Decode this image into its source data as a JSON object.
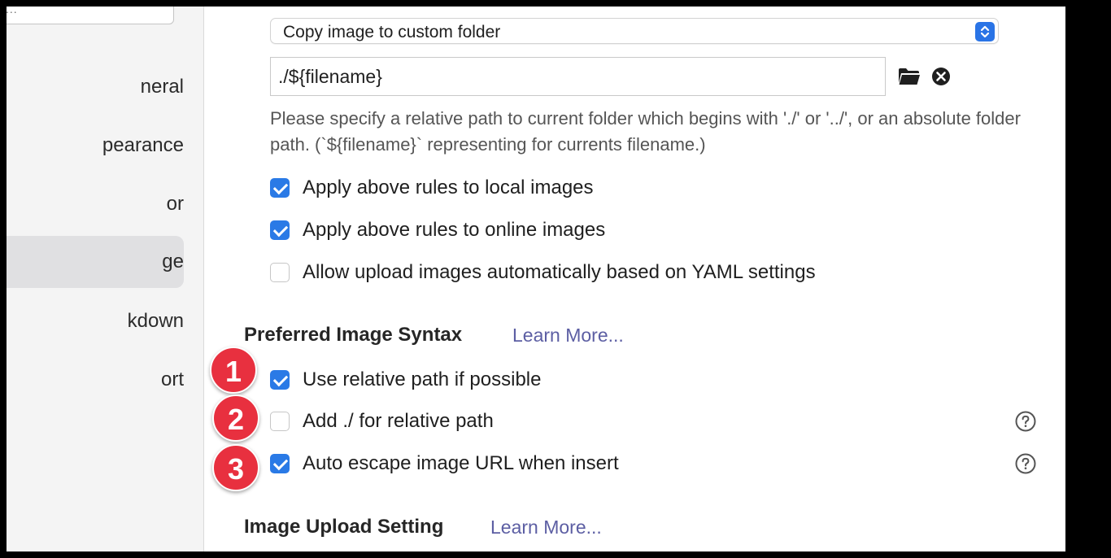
{
  "sidebar": {
    "search_placeholder": "...",
    "items": [
      {
        "label": "neral",
        "active": false
      },
      {
        "label": "pearance",
        "active": false
      },
      {
        "label": "or",
        "active": false
      },
      {
        "label": "ge",
        "active": true
      },
      {
        "label": "kdown",
        "active": false
      },
      {
        "label": "ort",
        "active": false
      }
    ]
  },
  "image_settings": {
    "insert_action": "Copy image to custom folder",
    "folder_path": "./${filename}",
    "hint": "Please specify a relative path to current folder which begins with './' or '../', or an absolute folder path. (`${filename}` representing for currents filename.)",
    "options": [
      {
        "label": "Apply above rules to local images",
        "checked": true
      },
      {
        "label": "Apply above rules to online images",
        "checked": true
      },
      {
        "label": "Allow upload images automatically based on YAML settings",
        "checked": false
      }
    ]
  },
  "syntax_section": {
    "title": "Preferred Image Syntax",
    "learn_more": "Learn More...",
    "options": [
      {
        "label": "Use relative path if possible",
        "checked": true,
        "badge": "1"
      },
      {
        "label": "Add ./ for relative path",
        "checked": false,
        "badge": "2"
      },
      {
        "label": "Auto escape image URL when insert",
        "checked": true,
        "badge": "3"
      }
    ]
  },
  "upload_section": {
    "title": "Image Upload Setting",
    "learn_more": "Learn More..."
  },
  "colors": {
    "accent": "#2a7ae6",
    "badge": "#e8303f",
    "link": "#5c5ea3"
  },
  "icons": {
    "folder": "folder-icon",
    "clear": "close-circle-icon",
    "help": "question-circle-icon",
    "select": "chevron-up-down-icon"
  }
}
